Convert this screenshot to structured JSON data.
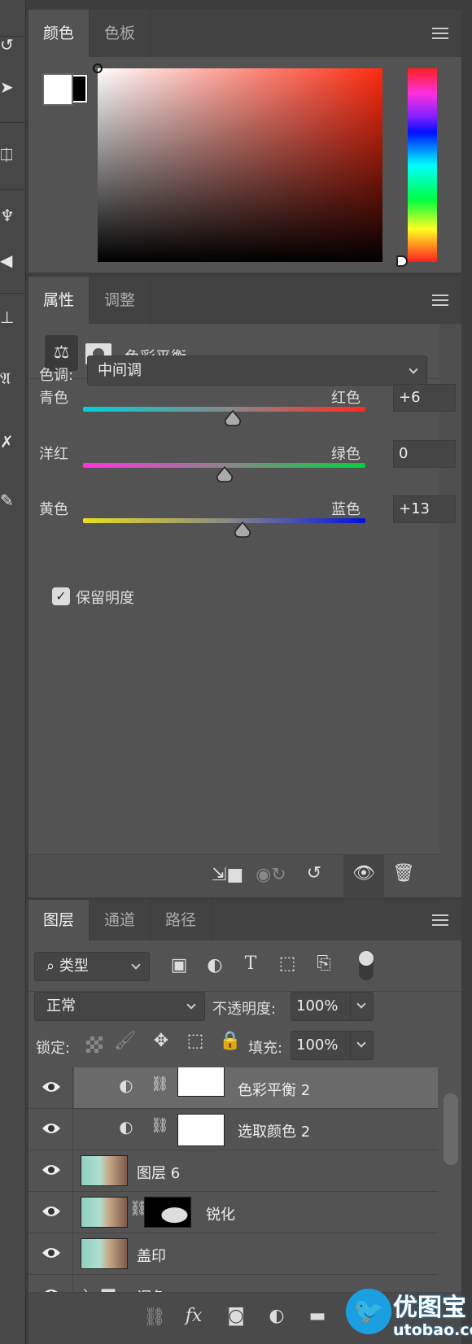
{
  "color_panel": {
    "tabs": [
      "颜色",
      "色板"
    ],
    "active_tab": 0,
    "foreground": "#ffffff",
    "background": "#000000",
    "hue_color": "#ff2a10"
  },
  "properties_panel": {
    "tabs": [
      "属性",
      "调整"
    ],
    "active_tab": 0,
    "adjustment_title": "色彩平衡",
    "tone_label": "色调:",
    "tone_value": "中间调",
    "sliders": [
      {
        "left": "青色",
        "right": "红色",
        "value": "+6",
        "num": 6,
        "from": "#00d0d8",
        "to": "#ff2a20"
      },
      {
        "left": "洋红",
        "right": "绿色",
        "value": "0",
        "num": 0,
        "from": "#ff30e0",
        "to": "#00d040"
      },
      {
        "left": "黄色",
        "right": "蓝色",
        "value": "+13",
        "num": 13,
        "from": "#e8e020",
        "to": "#0010e0"
      }
    ],
    "preserve_luminosity": {
      "label": "保留明度",
      "checked": true
    },
    "bottom_icons": [
      "clip-to-layer-icon",
      "view-previous-state-icon",
      "reset-icon",
      "visibility-icon",
      "delete-icon"
    ]
  },
  "layers_panel": {
    "tabs": [
      "图层",
      "通道",
      "路径"
    ],
    "active_tab": 0,
    "filter_kind": "类型",
    "blend_mode": "正常",
    "opacity_label": "不透明度:",
    "opacity": "100%",
    "lock_label": "锁定:",
    "fill_label": "填充:",
    "fill": "100%",
    "layers": [
      {
        "name": "色彩平衡 2",
        "type": "adjustment",
        "selected": true
      },
      {
        "name": "选取颜色 2",
        "type": "adjustment",
        "selected": false
      },
      {
        "name": "图层 6",
        "type": "pixel",
        "selected": false
      },
      {
        "name": "锐化",
        "type": "pixel-mask",
        "selected": false
      },
      {
        "name": "盖印",
        "type": "pixel",
        "selected": false
      },
      {
        "name": "调色",
        "type": "group",
        "selected": false
      }
    ]
  },
  "watermark": {
    "brand": "优图宝",
    "site": "utobao.com"
  }
}
